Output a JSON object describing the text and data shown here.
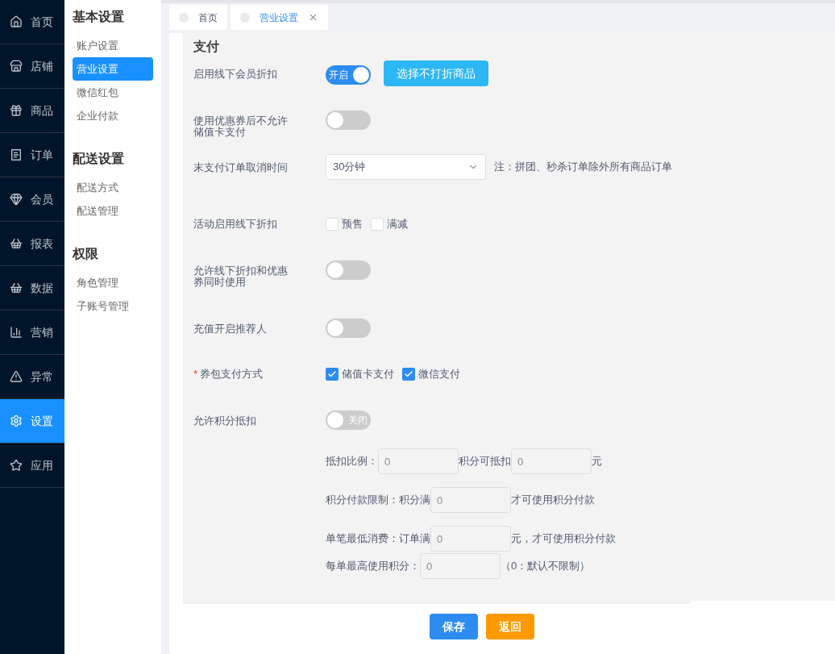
{
  "nav": [
    {
      "label": "首页",
      "selected": false
    },
    {
      "label": "店铺",
      "selected": false
    },
    {
      "label": "商品",
      "selected": false
    },
    {
      "label": "订单",
      "selected": false
    },
    {
      "label": "会员",
      "selected": false
    },
    {
      "label": "报表",
      "selected": false
    },
    {
      "label": "数据",
      "selected": false
    },
    {
      "label": "营销",
      "selected": false
    },
    {
      "label": "异常",
      "selected": false
    },
    {
      "label": "设置",
      "selected": true
    },
    {
      "label": "应用",
      "selected": false
    }
  ],
  "submenu": [
    {
      "title": "基本设置",
      "items": [
        {
          "label": "账户设置",
          "selected": false
        },
        {
          "label": "营业设置",
          "selected": true
        },
        {
          "label": "微信红包",
          "selected": false
        },
        {
          "label": "企业付款",
          "selected": false
        }
      ]
    },
    {
      "title": "配送设置",
      "items": [
        {
          "label": "配送方式",
          "selected": false
        },
        {
          "label": "配送管理",
          "selected": false
        }
      ]
    },
    {
      "title": "权限",
      "items": [
        {
          "label": "角色管理",
          "selected": false
        },
        {
          "label": "子账号管理",
          "selected": false
        }
      ]
    }
  ],
  "tabs": [
    {
      "label": "首页",
      "selected": false,
      "closable": false
    },
    {
      "label": "营业设置",
      "selected": true,
      "closable": true
    }
  ],
  "section_title": "支付",
  "rows": [
    {
      "kind": "toggle",
      "label": "启用线下会员折扣",
      "on": true,
      "toggle_text": "开启",
      "button": "选择不打折商品"
    },
    {
      "kind": "toggle",
      "label": "使用优惠券后不允许储值卡支付",
      "on": false
    },
    {
      "kind": "select",
      "label": "末支付订单取消时间",
      "value": "30分钟",
      "note": "注：拼团、秒杀订单除外所有商品订单"
    },
    {
      "kind": "checks",
      "label": "活动启用线下折扣",
      "options": [
        {
          "label": "预售",
          "checked": false
        },
        {
          "label": "满减",
          "checked": false
        }
      ]
    },
    {
      "kind": "toggle",
      "label": "允许线下折扣和优惠券同时使用",
      "on": false
    },
    {
      "kind": "toggle",
      "label": "充值开启推荐人",
      "on": false
    },
    {
      "kind": "checks",
      "label": "券包支付方式",
      "required_mark": "*",
      "options": [
        {
          "label": "储值卡支付",
          "checked": true
        },
        {
          "label": "微信支付",
          "checked": true
        }
      ]
    },
    {
      "kind": "toggle",
      "label": "允许积分抵扣",
      "on": false,
      "toggle_text": "关闭"
    }
  ],
  "points": [
    [
      {
        "kind": "text",
        "text": "抵扣比例："
      },
      {
        "kind": "input",
        "placeholder": "0"
      },
      {
        "kind": "text",
        "text": "积分可抵扣"
      },
      {
        "kind": "input",
        "placeholder": "0"
      },
      {
        "kind": "text",
        "text": "元"
      }
    ],
    [
      {
        "kind": "text",
        "text": "积分付款限制：积分满"
      },
      {
        "kind": "input",
        "placeholder": "0"
      },
      {
        "kind": "text",
        "text": "才可使用积分付款"
      }
    ],
    [
      {
        "kind": "text",
        "text": "单笔最低消费：订单满"
      },
      {
        "kind": "input",
        "placeholder": "0"
      },
      {
        "kind": "text",
        "text": "元，才可使用积分付款"
      }
    ],
    [
      {
        "kind": "text",
        "text": "每单最高使用积分："
      },
      {
        "kind": "input",
        "placeholder": "0"
      },
      {
        "kind": "text",
        "text": "（0：默认不限制）"
      }
    ]
  ],
  "actions": [
    {
      "label": "保存",
      "kind": "primary"
    },
    {
      "label": "返回",
      "kind": "warning"
    }
  ]
}
